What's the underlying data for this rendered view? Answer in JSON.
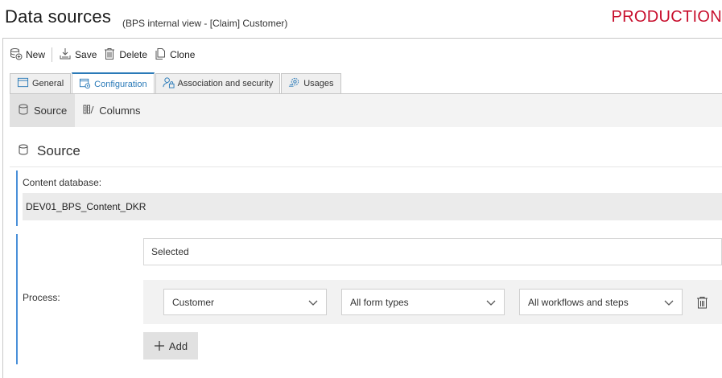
{
  "header": {
    "title": "Data sources",
    "subtitle": "(BPS internal view - [Claim] Customer)",
    "environment": "PRODUCTION",
    "environment_color": "#c8102e"
  },
  "toolbar": {
    "new_label": "New",
    "save_label": "Save",
    "delete_label": "Delete",
    "clone_label": "Clone"
  },
  "tabs": [
    {
      "label": "General",
      "icon": "window-icon",
      "active": false
    },
    {
      "label": "Configuration",
      "icon": "config-icon",
      "active": true
    },
    {
      "label": "Association and security",
      "icon": "user-lock-icon",
      "active": false
    },
    {
      "label": "Usages",
      "icon": "usages-gear-icon",
      "active": false
    }
  ],
  "subnav": [
    {
      "label": "Source",
      "icon": "database-icon",
      "active": true
    },
    {
      "label": "Columns",
      "icon": "columns-icon",
      "active": false
    }
  ],
  "section": {
    "title": "Source",
    "icon": "database-icon"
  },
  "content_database": {
    "label": "Content database:",
    "value": "DEV01_BPS_Content_DKR"
  },
  "process": {
    "label": "Process:",
    "mode": "Selected",
    "row": {
      "process": "Customer",
      "form_types": "All form types",
      "workflows": "All workflows and steps"
    },
    "add_label": "Add"
  },
  "colors": {
    "accent": "#2a7ab8",
    "field_bar": "#4a90d9"
  }
}
